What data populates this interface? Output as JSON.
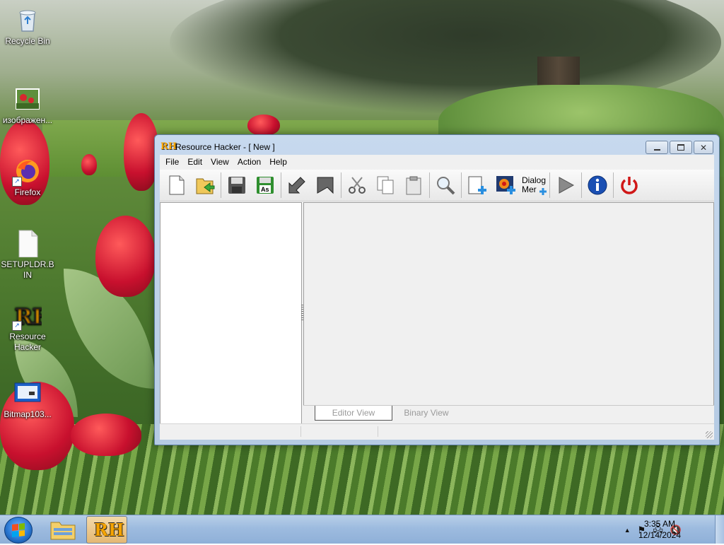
{
  "desktop": {
    "icons": [
      {
        "label": "Recycle Bin",
        "icon": "recycle-bin-icon"
      },
      {
        "label": "изображен...",
        "icon": "image-file-icon"
      },
      {
        "label": "Firefox",
        "icon": "firefox-icon"
      },
      {
        "label": "SETUPLDR.BIN",
        "icon": "file-icon"
      },
      {
        "label": "Resource Hacker",
        "icon": "resource-hacker-icon"
      },
      {
        "label": "Bitmap103...",
        "icon": "bitmap-file-icon"
      }
    ]
  },
  "window": {
    "app_icon_text": "RH",
    "title": "Resource Hacker - [ New ]",
    "controls": {
      "minimize": "minimize",
      "maximize": "maximize",
      "close": "close"
    },
    "menu": [
      "File",
      "Edit",
      "View",
      "Action",
      "Help"
    ],
    "toolbar": {
      "buttons": [
        "new-file-icon",
        "open-file-icon",
        "save-icon",
        "save-as-icon",
        "compile-icon",
        "go-icon",
        "cut-icon",
        "copy-icon",
        "paste-icon",
        "find-icon",
        "add-resource-icon",
        "add-image-resource-icon",
        "dialog-menu-icon",
        "run-script-icon",
        "info-icon",
        "exit-icon"
      ],
      "save_as_text": "As",
      "dialog_menu_label": "Dialog Mer"
    },
    "tabs": {
      "editor": "Editor View",
      "binary": "Binary View"
    }
  },
  "taskbar": {
    "rh_label": "RH",
    "clock_time": "3:35 AM",
    "clock_date": "12/14/2024",
    "tray_icons": [
      "show-hidden-icons-arrow",
      "action-center-flag-icon",
      "network-icon",
      "volume-muted-icon"
    ]
  },
  "colors": {
    "window_frame": "#b5cbe3",
    "rh_orange": "#f5a300",
    "taskbar": "#9dbbdf",
    "info_blue": "#1a4fb3",
    "power_red": "#d01818",
    "active_tab_text": "#9a9a9a"
  }
}
